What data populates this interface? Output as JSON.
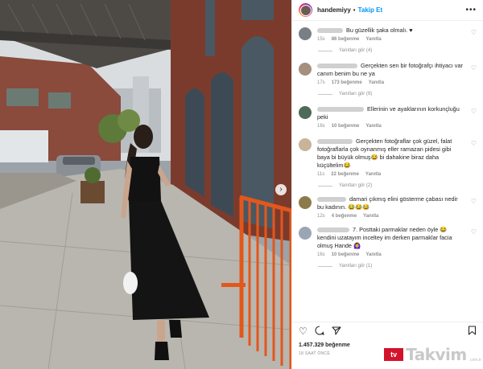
{
  "post": {
    "username": "handemiyy",
    "follow_label": "Takip Et",
    "separator": "•",
    "more_icon": "more-icon",
    "carousel_arrow": "›"
  },
  "comments": [
    {
      "text": "Bu güzellik şaka olmalı.",
      "suffix": "♥",
      "time": "15s",
      "likes": "86 beğenme",
      "reply": "Yanıtla",
      "replies": "Yanıtları gör (4)",
      "avatar_color": "#7a7f86"
    },
    {
      "text": "Gerçekten sen bir fotoğrafçı ihtiyacı var canım benim bu ne ya",
      "time": "17s",
      "likes": "173 beğenme",
      "reply": "Yanıtla",
      "replies": "Yanıtları gör (9)",
      "avatar_color": "#a58f7d"
    },
    {
      "text": "Ellerinin ve ayaklarının korkunçluğu peki",
      "time": "16s",
      "likes": "10 beğenme",
      "reply": "Yanıtla",
      "replies": "",
      "avatar_color": "#4f6b55"
    },
    {
      "text": "Gerçekten fotoğraflar çok güzel, falat fotoğraflarla çok oynanmış eller ramazan pidesi gibi baya bi büyük olmuş😂 bi dahakine biraz daha küçültelim😂",
      "time": "11s",
      "likes": "22 beğenme",
      "reply": "Yanıtla",
      "replies": "Yanıtları gör (2)",
      "avatar_color": "#c9b49a"
    },
    {
      "text": "damari çıkmış elini gösterme çabası nedir bu kadının. 😂😂😂",
      "time": "12s",
      "likes": "4 beğenme",
      "reply": "Yanıtla",
      "replies": "",
      "avatar_color": "#8c7a4a"
    },
    {
      "text": "7. Posttaki parmaklar neden öyle 😂 kendini uzatayım inceltey im derken parmaklar facia olmuş Hande 🙆‍♀️",
      "time": "16s",
      "likes": "10 beğenme",
      "reply": "Yanıtla",
      "replies": "Yanıtları gör (1)",
      "avatar_color": "#9aa6b3"
    }
  ],
  "actions": {
    "like_icon": "heart-icon",
    "comment_icon": "comment-icon",
    "share_icon": "share-icon",
    "save_icon": "bookmark-icon"
  },
  "stats": {
    "likes": "1.457.329 beğenme",
    "time": "18 SAAT ÖNCE"
  },
  "watermark": {
    "box": "tv",
    "brand": "Takvim",
    "suffix": ".com.tr"
  }
}
